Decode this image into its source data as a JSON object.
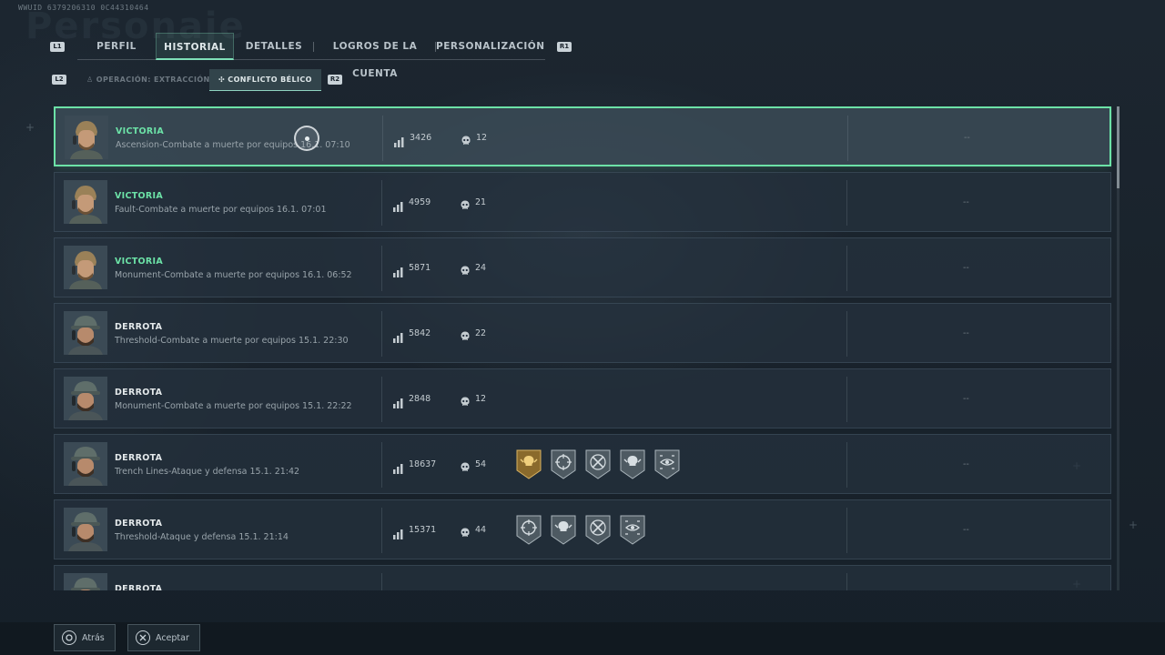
{
  "uid": "WWUID 6379206310 0C44310464",
  "ghost_title": "Personaje",
  "topnav": {
    "left_hint": "L1",
    "right_hint": "R1",
    "tabs": [
      {
        "label": "PERFIL"
      },
      {
        "label": "HISTORIAL",
        "active": true
      },
      {
        "label": "DETALLES"
      },
      {
        "label": "LOGROS DE LA CUENTA"
      },
      {
        "label": "PERSONALIZACIÓN"
      }
    ]
  },
  "subnav": {
    "left_hint": "L2",
    "right_hint": "R2",
    "tabs": [
      {
        "label": "OPERACIÓN: EXTRACCIÓN",
        "icon": "extraction-icon"
      },
      {
        "label": "CONFLICTO BÉLICO",
        "icon": "conflict-icon",
        "active": true
      }
    ]
  },
  "matches": [
    {
      "result": "VICTORIA",
      "outcome": "win",
      "details": "Ascension-Combate a muerte por equipos 16.1. 07:10",
      "score": "3426",
      "kills": "12",
      "medals": [],
      "extra": "--"
    },
    {
      "result": "VICTORIA",
      "outcome": "win",
      "details": "Fault-Combate a muerte por equipos 16.1. 07:01",
      "score": "4959",
      "kills": "21",
      "medals": [],
      "extra": "--"
    },
    {
      "result": "VICTORIA",
      "outcome": "win",
      "details": "Monument-Combate a muerte por equipos 16.1. 06:52",
      "score": "5871",
      "kills": "24",
      "medals": [],
      "extra": "--"
    },
    {
      "result": "DERROTA",
      "outcome": "loss",
      "details": "Threshold-Combate a muerte por equipos 15.1. 22:30",
      "score": "5842",
      "kills": "22",
      "medals": [],
      "extra": "--"
    },
    {
      "result": "DERROTA",
      "outcome": "loss",
      "details": "Monument-Combate a muerte por equipos 15.1. 22:22",
      "score": "2848",
      "kills": "12",
      "medals": [],
      "extra": "--"
    },
    {
      "result": "DERROTA",
      "outcome": "loss",
      "details": "Trench Lines-Ataque y defensa 15.1. 21:42",
      "score": "18637",
      "kills": "54",
      "medals": [
        "gold-skull-medal-icon",
        "target-skull-medal-icon",
        "crossed-rifles-medal-icon",
        "skull-wings-medal-icon",
        "eye-scope-medal-icon"
      ],
      "extra": "--"
    },
    {
      "result": "DERROTA",
      "outcome": "loss",
      "details": "Threshold-Ataque y defensa 15.1. 21:14",
      "score": "15371",
      "kills": "44",
      "medals": [
        "crosshair-rifle-medal-icon",
        "skull-wings-medal-icon",
        "crossed-rifles-medal-icon",
        "eye-scope-medal-icon"
      ],
      "extra": "--"
    },
    {
      "result": "DERROTA",
      "outcome": "loss",
      "details": "",
      "score": "",
      "kills": "",
      "medals": [],
      "extra": ""
    }
  ],
  "bottom": {
    "back_label": "Atrás",
    "accept_label": "Aceptar"
  },
  "colors": {
    "accent": "#6ce2a7",
    "victory": "#6ce2a7",
    "defeat": "#e3e8ea",
    "background": "#1c2630"
  }
}
